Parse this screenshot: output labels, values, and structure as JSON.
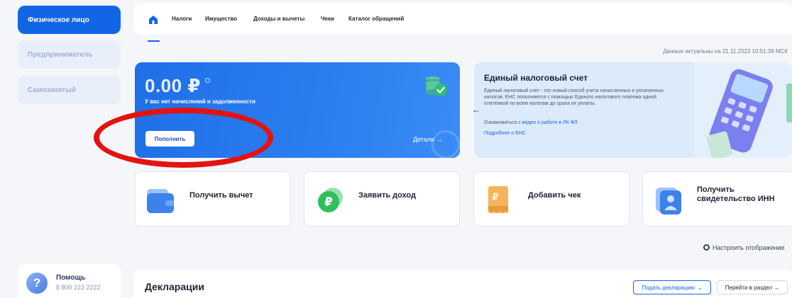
{
  "sidebar": {
    "items": [
      {
        "label": "Физическое лицо"
      },
      {
        "label": "Предприниматель"
      },
      {
        "label": "Самозанятый"
      }
    ],
    "help": {
      "title": "Помощь",
      "phone": "8 800 222 2222",
      "icon": "question-icon"
    }
  },
  "nav": {
    "home_icon": "home-icon",
    "items": [
      {
        "label": "Налоги"
      },
      {
        "label": "Имущество"
      },
      {
        "label": "Доходы и вычеты"
      },
      {
        "label": "Чеки"
      },
      {
        "label": "Каталог обращений"
      }
    ]
  },
  "actual_date": "Данные актуальны на 21.11.2023 10:51:39 МСК",
  "balance": {
    "amount": "0.00 ₽",
    "status": "У вас нет начислений и задолженности",
    "topup_label": "Пополнить",
    "details_label": "Детали →"
  },
  "ens": {
    "title": "Единый налоговый счет",
    "description": "Единый налоговый счет - это новый способ учета начисленных и уплаченных налогов. ЕНС пополняется с помощью Единого налогового платежа одной платёжкой по всем налогам до срока их уплаты.",
    "video_prefix": "Ознакомиться с ",
    "video_link": "видео о работе в ЛК ФЛ",
    "more_link": "Подробнее о ЕНС",
    "prev_arrow": "←"
  },
  "tiles": [
    {
      "label": "Получить вычет",
      "icon": "wallet-icon"
    },
    {
      "label": "Заявить доход",
      "icon": "ruble-coin-icon"
    },
    {
      "label": "Добавить чек",
      "icon": "receipt-icon"
    },
    {
      "label": "Получить свидетельство ИНН",
      "icon": "id-card-icon"
    }
  ],
  "settings_label": "Настроить отображение",
  "declarations": {
    "title": "Декларации",
    "submit_label": "Подать декларацию",
    "goto_label": "Перейти в раздел →"
  },
  "colors": {
    "accent": "#1266e5",
    "annotation": "#e3130f",
    "ens_bg": "#dcebfb"
  }
}
